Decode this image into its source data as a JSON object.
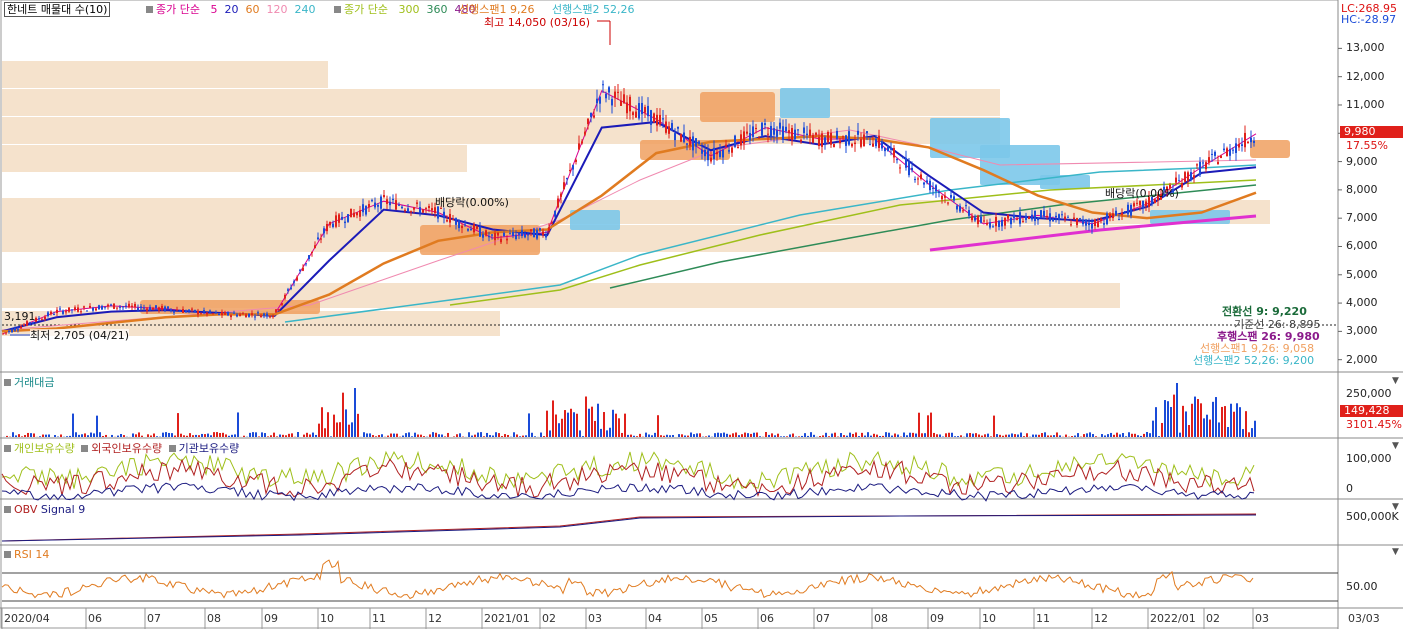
{
  "header": {
    "stock_label": "한네트 매물대 수(10)",
    "ma_prefix": "종가 단순",
    "ma_short": [
      "5",
      "20",
      "60",
      "120",
      "240"
    ],
    "ma_short_colors": [
      "#d9008f",
      "#1b1bb8",
      "#e07b20",
      "#f08ab0",
      "#3ab6c8"
    ],
    "ma_prefix2": "종가 단순",
    "ma_long": [
      "300",
      "360",
      "480"
    ],
    "ma_long_colors": [
      "#9fbf1a",
      "#2e8b57",
      "#8b1a8b"
    ],
    "span1_label": "선행스팬1 9,26",
    "span2_label": "선행스팬2 52,26",
    "lc": "LC:268.95",
    "hc": "HC:-28.97"
  },
  "annotations": {
    "high": "최고 14,050 (03/16)",
    "low": "최저 2,705 (04/21)",
    "dividend1": "배당락(0.00%)",
    "dividend2": "배당락(0.00%)",
    "ref_price": "3,191"
  },
  "legend_values": {
    "conversion": "전환선 9: 9,220",
    "base": "기준선 26: 8,895",
    "lagging": "후행스팬 26: 9,980",
    "span1": "선행스팬1 9,26: 9,058",
    "span2": "선행스팬2 52,26: 9,200"
  },
  "badges": {
    "price": "9,980",
    "price_pct": "17.55%",
    "volume": "149,428",
    "volume_pct": "3101.45%"
  },
  "panels": {
    "volume_title": "거래대금",
    "holdings_title_1": "개인보유수량",
    "holdings_title_2": "외국인보유수량",
    "holdings_title_3": "기관보유수량",
    "obv_title": "OBV",
    "obv_signal": "Signal 9",
    "rsi_title": "RSI 14"
  },
  "axes": {
    "price_ticks": [
      "13,000",
      "12,000",
      "11,000",
      "10,000",
      "9,000",
      "8,000",
      "7,000",
      "6,000",
      "5,000",
      "4,000",
      "3,000",
      "2,000"
    ],
    "volume_ticks": [
      "250,000"
    ],
    "holdings_ticks": [
      "100,000",
      "0"
    ],
    "obv_ticks": [
      "500,000K"
    ],
    "rsi_ticks": [
      "50.00"
    ],
    "x_ticks": [
      "2020/04",
      "06",
      "07",
      "08",
      "09",
      "10",
      "11",
      "12",
      "2021/01",
      "02",
      "03",
      "04",
      "05",
      "06",
      "07",
      "08",
      "09",
      "10",
      "11",
      "12",
      "2022/01",
      "02",
      "03"
    ],
    "x_cursor": "03/03"
  },
  "chart_data": {
    "type": "line",
    "x": [
      "2020/04",
      "2020/05",
      "2020/06",
      "2020/07",
      "2020/08",
      "2020/09",
      "2020/10",
      "2020/11",
      "2020/12",
      "2021/01",
      "2021/02",
      "2021/03",
      "2021/04",
      "2021/05",
      "2021/06",
      "2021/07",
      "2021/08",
      "2021/09",
      "2021/10",
      "2021/11",
      "2021/12",
      "2022/01",
      "2022/02",
      "2022/03"
    ],
    "series": [
      {
        "name": "종가",
        "values": [
          2900,
          3700,
          3900,
          3800,
          3600,
          3600,
          6800,
          7600,
          7200,
          6300,
          6500,
          11500,
          10500,
          9200,
          10200,
          9800,
          9800,
          8200,
          6800,
          7100,
          6800,
          7500,
          8800,
          9980
        ]
      },
      {
        "name": "20",
        "values": [
          3000,
          3500,
          3700,
          3750,
          3650,
          3550,
          5500,
          7300,
          7100,
          6600,
          6400,
          10200,
          10400,
          9400,
          9900,
          9600,
          9900,
          8500,
          7200,
          7000,
          6900,
          7400,
          8600,
          8800
        ]
      },
      {
        "name": "60",
        "values": [
          3000,
          3100,
          3300,
          3500,
          3600,
          3600,
          4300,
          5400,
          6200,
          6500,
          6600,
          7800,
          9300,
          9700,
          9800,
          9900,
          9800,
          9500,
          8700,
          7800,
          7200,
          7000,
          7200,
          7900
        ]
      }
    ],
    "ylim": [
      1600,
      14500
    ],
    "ylabel": "",
    "xlabel": "",
    "grid": false
  }
}
